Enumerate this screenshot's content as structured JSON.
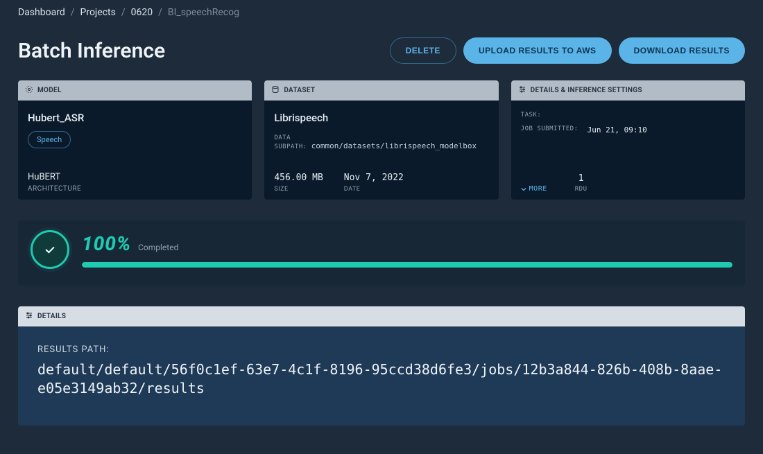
{
  "breadcrumb": {
    "items": [
      "Dashboard",
      "Projects",
      "0620",
      "BI_speechRecog"
    ]
  },
  "header": {
    "title": "Batch Inference",
    "delete": "DELETE",
    "upload": "UPLOAD RESULTS TO AWS",
    "download": "DOWNLOAD RESULTS"
  },
  "model_card": {
    "header": "MODEL",
    "name": "Hubert_ASR",
    "chip": "Speech",
    "arch_name": "HuBERT",
    "arch_label": "ARCHITECTURE"
  },
  "dataset_card": {
    "header": "DATASET",
    "name": "Librispeech",
    "subpath_label": "DATA SUBPATH:",
    "subpath_value": "common/datasets/librispeech_modelbox",
    "size_value": "456.00 MB",
    "size_label": "SIZE",
    "date_value": "Nov 7, 2022",
    "date_label": "DATE"
  },
  "settings_card": {
    "header": "DETAILS & INFERENCE SETTINGS",
    "task_label": "TASK:",
    "task_value": "",
    "submitted_label": "JOB SUBMITTED:",
    "submitted_value": "Jun 21, 09:10",
    "more": "MORE",
    "rdu_value": "1",
    "rdu_label": "RDU"
  },
  "progress": {
    "pct": "100%",
    "status": "Completed"
  },
  "details_panel": {
    "header": "DETAILS",
    "results_label": "RESULTS PATH:",
    "results_path": "default/default/56f0c1ef-63e7-4c1f-8196-95ccd38d6fe3/jobs/12b3a844-826b-408b-8aae-e05e3149ab32/results"
  }
}
